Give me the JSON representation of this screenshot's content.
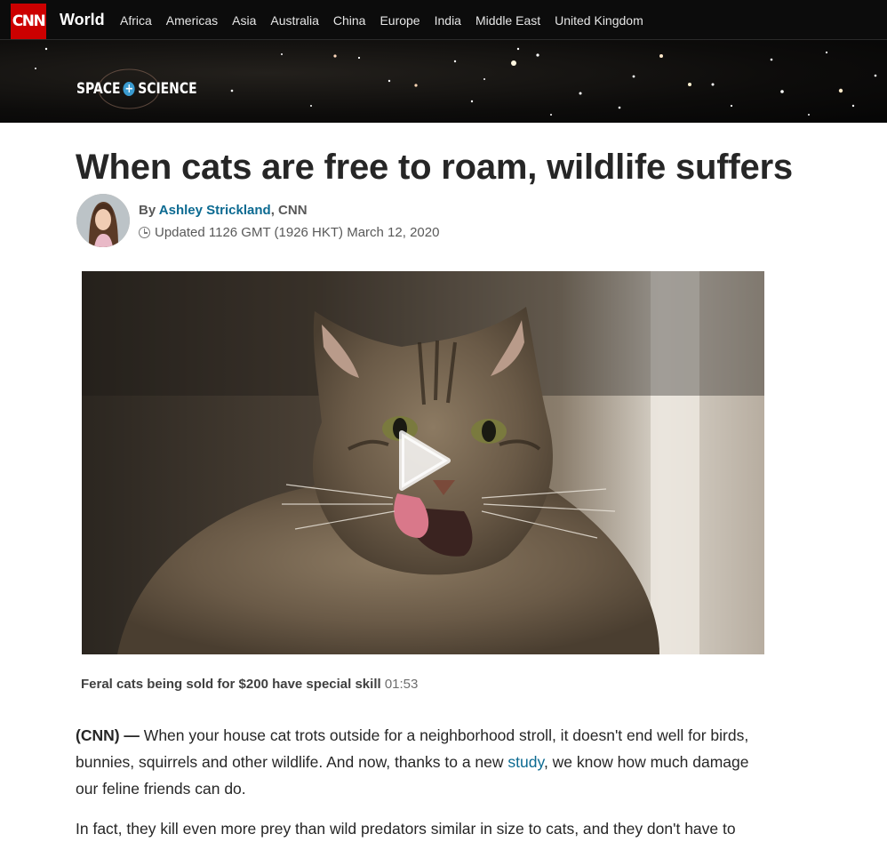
{
  "nav": {
    "logo": "CNN",
    "section": "World",
    "items": [
      "Africa",
      "Americas",
      "Asia",
      "Australia",
      "China",
      "Europe",
      "India",
      "Middle East",
      "United Kingdom"
    ]
  },
  "banner": {
    "left": "SPACE",
    "plus": "+",
    "right": "SCIENCE"
  },
  "article": {
    "headline": "When cats are free to roam, wildlife suffers",
    "by": "By ",
    "author": "Ashley Strickland",
    "source": ", CNN",
    "updated": "Updated 1126 GMT (1926 HKT) March 12, 2020"
  },
  "video": {
    "title": "Feral cats being sold for $200 have special skill",
    "duration": "01:53"
  },
  "body": {
    "lead": "(CNN) —",
    "p1_a": " When your house cat trots outside for a neighborhood stroll, it doesn't end well for birds, bunnies, squirrels and other wildlife. And now, thanks to a new ",
    "p1_link": "study",
    "p1_b": ", we know how much damage our feline friends can do.",
    "p2": "In fact, they kill even more prey than wild predators similar in size to cats, and they don't have to"
  },
  "colors": {
    "brand_red": "#cc0000",
    "link_blue": "#0c6a91",
    "nav_bg": "#0c0c0c"
  }
}
